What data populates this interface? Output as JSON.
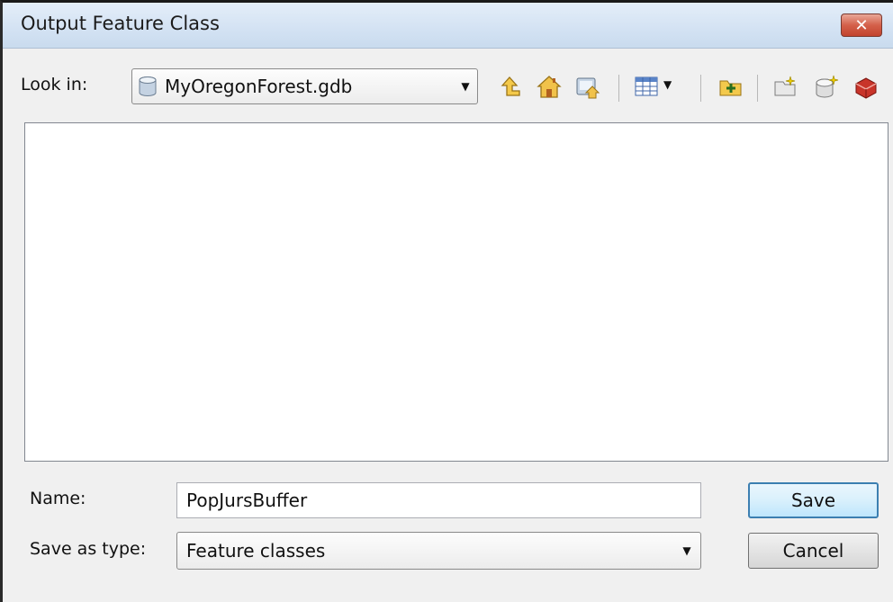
{
  "window": {
    "title": "Output Feature Class",
    "close_glyph": "✕"
  },
  "lookin": {
    "label": "Look in:",
    "value": "MyOregonForest.gdb"
  },
  "toolbar": [
    "up-one-level-icon",
    "home-icon",
    "connect-folder-icon",
    "view-list-icon",
    "new-folder-icon",
    "new-item-icon",
    "new-database-icon",
    "toolbox-icon"
  ],
  "form": {
    "name_label": "Name:",
    "name_value": "PopJursBuffer",
    "type_label": "Save as type:",
    "type_value": "Feature classes"
  },
  "buttons": {
    "save": "Save",
    "cancel": "Cancel"
  },
  "colors": {
    "titlebar": "#d3e2f3",
    "close": "#c2432e",
    "default_button_border": "#3c7fb1"
  }
}
